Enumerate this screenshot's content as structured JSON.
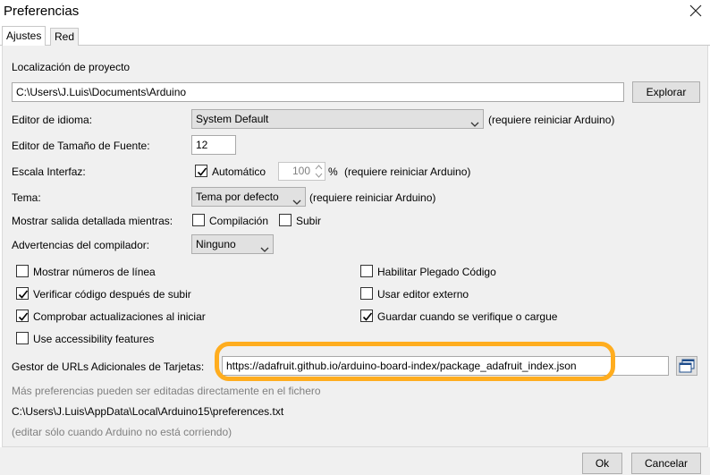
{
  "window": {
    "title": "Preferencias"
  },
  "tabs": [
    "Ajustes",
    "Red"
  ],
  "sketchbook": {
    "label": "Localización de proyecto",
    "path": "C:\\Users\\J.Luis\\Documents\\Arduino",
    "browse_label": "Explorar"
  },
  "language": {
    "label": "Editor de idioma:",
    "value": "System Default",
    "note": "(requiere reiniciar Arduino)"
  },
  "font_size": {
    "label": "Editor de Tamaño de Fuente:",
    "value": "12"
  },
  "scale": {
    "label": "Escala Interfaz:",
    "auto_label": "Automático",
    "auto_checked": true,
    "value": "100",
    "unit": "%",
    "note": "(requiere reiniciar Arduino)"
  },
  "theme": {
    "label": "Tema:",
    "value": "Tema por defecto",
    "note": "(requiere reiniciar Arduino)"
  },
  "verbose": {
    "label": "Mostrar salida detallada mientras:",
    "compile_label": "Compilación",
    "compile_checked": false,
    "upload_label": "Subir",
    "upload_checked": false
  },
  "warnings": {
    "label": "Advertencias del compilador:",
    "value": "Ninguno"
  },
  "options_left": [
    {
      "label": "Mostrar números de línea",
      "checked": false
    },
    {
      "label": "Verificar código después de subir",
      "checked": true
    },
    {
      "label": "Comprobar actualizaciones al iniciar",
      "checked": true
    },
    {
      "label": "Use accessibility features",
      "checked": false
    }
  ],
  "options_right": [
    {
      "label": "Habilitar Plegado Código",
      "checked": false
    },
    {
      "label": "Usar editor externo",
      "checked": false
    },
    {
      "label": "Guardar cuando se verifique o cargue",
      "checked": true
    }
  ],
  "board_urls": {
    "label": "Gestor de URLs Adicionales de Tarjetas:",
    "value": "https://adafruit.github.io/arduino-board-index/package_adafruit_index.json"
  },
  "more_prefs": {
    "note": "Más preferencias pueden ser editadas directamente en el fichero",
    "path": "C:\\Users\\J.Luis\\AppData\\Local\\Arduino15\\preferences.txt",
    "warning": "(editar sólo cuando Arduino no está corriendo)"
  },
  "footer": {
    "ok_label": "Ok",
    "cancel_label": "Cancelar"
  },
  "colors": {
    "highlight": "#ffad1f",
    "panel": "#f0f0f0"
  }
}
